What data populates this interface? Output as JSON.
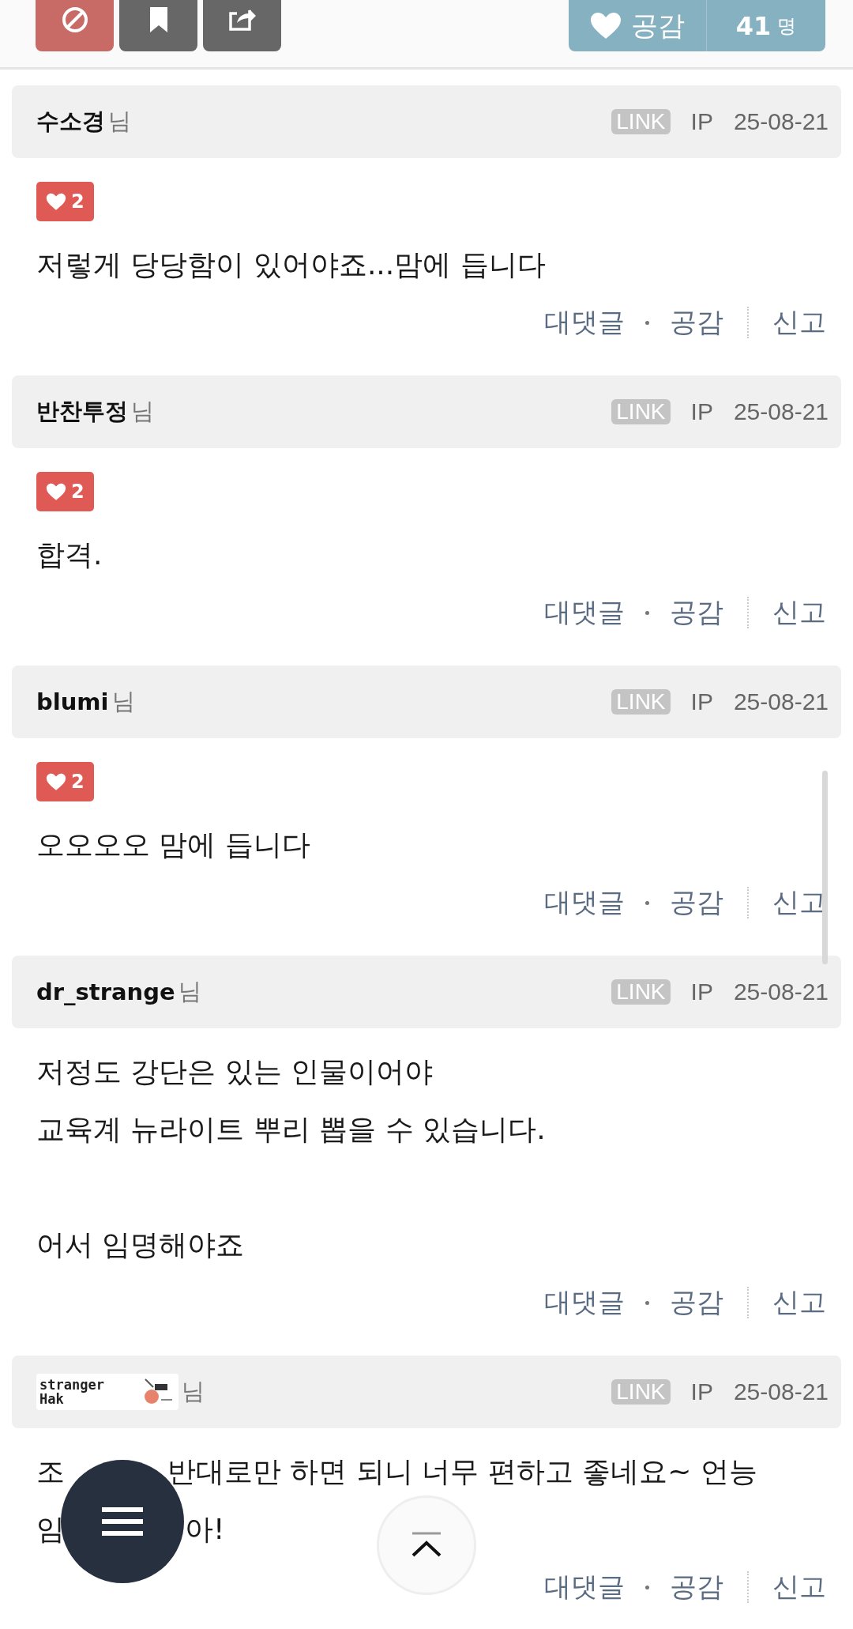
{
  "top_bar": {
    "buttons": [
      {
        "kind": "block"
      },
      {
        "kind": "bookmark"
      },
      {
        "kind": "share"
      }
    ],
    "like": {
      "label": "공감",
      "count": "41",
      "unit": "명"
    }
  },
  "comments": [
    {
      "nickname": {
        "kind": "text",
        "text": "수소경"
      },
      "suffix": "님",
      "link": "LINK",
      "ip": "IP",
      "date": "25-08-21",
      "likes": "2",
      "body": [
        [
          [
            "저렇게 당당함이 있어야죠...맘에 듭니다"
          ]
        ]
      ],
      "actions": [
        "대댓글",
        "공감",
        "신고"
      ]
    },
    {
      "nickname": {
        "kind": "text",
        "text": "반찬투정"
      },
      "suffix": "님",
      "link": "LINK",
      "ip": "IP",
      "date": "25-08-21",
      "likes": "2",
      "body": [
        [
          [
            "합격."
          ]
        ]
      ],
      "actions": [
        "대댓글",
        "공감",
        "신고"
      ]
    },
    {
      "nickname": {
        "kind": "text",
        "text": "blumi"
      },
      "suffix": "님",
      "link": "LINK",
      "ip": "IP",
      "date": "25-08-21",
      "likes": "2",
      "body": [
        [
          [
            "오오오오 맘에 듭니다"
          ]
        ]
      ],
      "actions": [
        "대댓글",
        "공감",
        "신고"
      ]
    },
    {
      "nickname": {
        "kind": "text",
        "text": "dr_strange"
      },
      "suffix": "님",
      "link": "LINK",
      "ip": "IP",
      "date": "25-08-21",
      "body": [
        [
          [
            "저정도 강단은 있는 인물이어야"
          ],
          [
            "교육계 뉴라이트 뿌리 뽑을 수 있습니다."
          ]
        ],
        [
          [
            "어서 임명해야죠"
          ]
        ]
      ],
      "actions": [
        "대댓글",
        "공감",
        "신고"
      ]
    },
    {
      "nickname": {
        "kind": "image",
        "lines": [
          "stranger",
          "Hak"
        ]
      },
      "suffix": "님",
      "link": "LINK",
      "ip": "IP",
      "date": "25-08-21",
      "body": [
        [
          [
            "조",
            "반대로만 하면 되니 너무 편하고 좋네요~ 언능"
          ],
          [
            "임",
            "아!"
          ]
        ]
      ],
      "actions": [
        "대댓글",
        "공감",
        "신고"
      ]
    }
  ]
}
